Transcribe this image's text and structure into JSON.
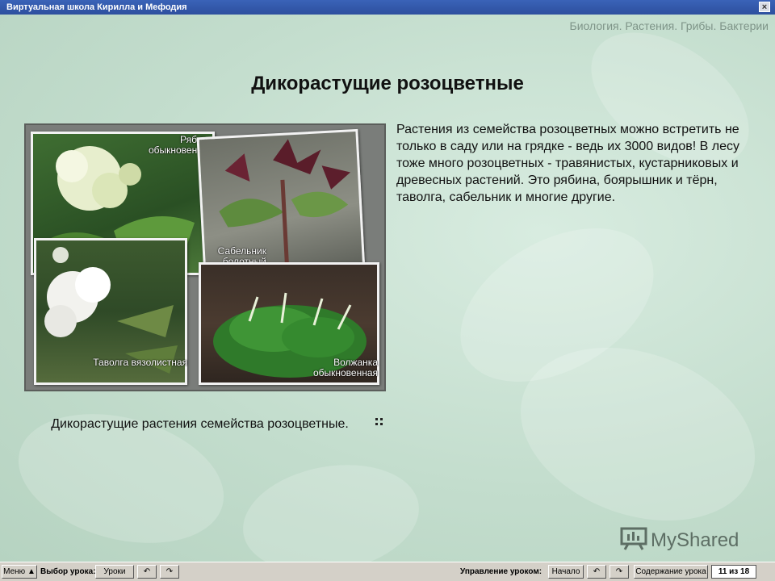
{
  "window": {
    "title": "Виртуальная школа Кирилла и Мефодия",
    "close_glyph": "×"
  },
  "subject_breadcrumb": "Биология. Растения. Грибы. Бактерии",
  "slide": {
    "heading": "Дикорастущие розоцветные",
    "paragraph": "Растения из семейства розоцветных можно встретить не только в саду или на грядке - ведь их 3000 видов! В лесу тоже много розоцветных - травянистых, кустарниковых и древесных растений. Это рябина, боярышник и тёрн, таволга, сабельник и многие другие.",
    "photo_labels": {
      "rowan": "Рябина обыкновенная",
      "cinquefoil": "Сабельник болотный",
      "meadowsweet": "Таволга вязолистная",
      "goatsbeard": "Волжанка обыкновенная"
    },
    "caption": "Дикорастущие растения семейства розоцветные."
  },
  "watermark": {
    "text": "MyShared",
    "icon": "presentation-icon"
  },
  "toolbar": {
    "menu_label": "Меню ▲",
    "lesson_choice_label": "Выбор урока:",
    "lessons_button": "Уроки",
    "lesson_control_label": "Управление уроком:",
    "start_button": "Начало",
    "contents_button": "Содержание урока",
    "counter": "11 из 18",
    "back_icon": "undo-arrow-icon",
    "forward_icon": "redo-arrow-icon"
  },
  "colors": {
    "titlebar": "#2d4f9e",
    "background": "#c3ddcd",
    "toolbar": "#d4d0c8"
  }
}
